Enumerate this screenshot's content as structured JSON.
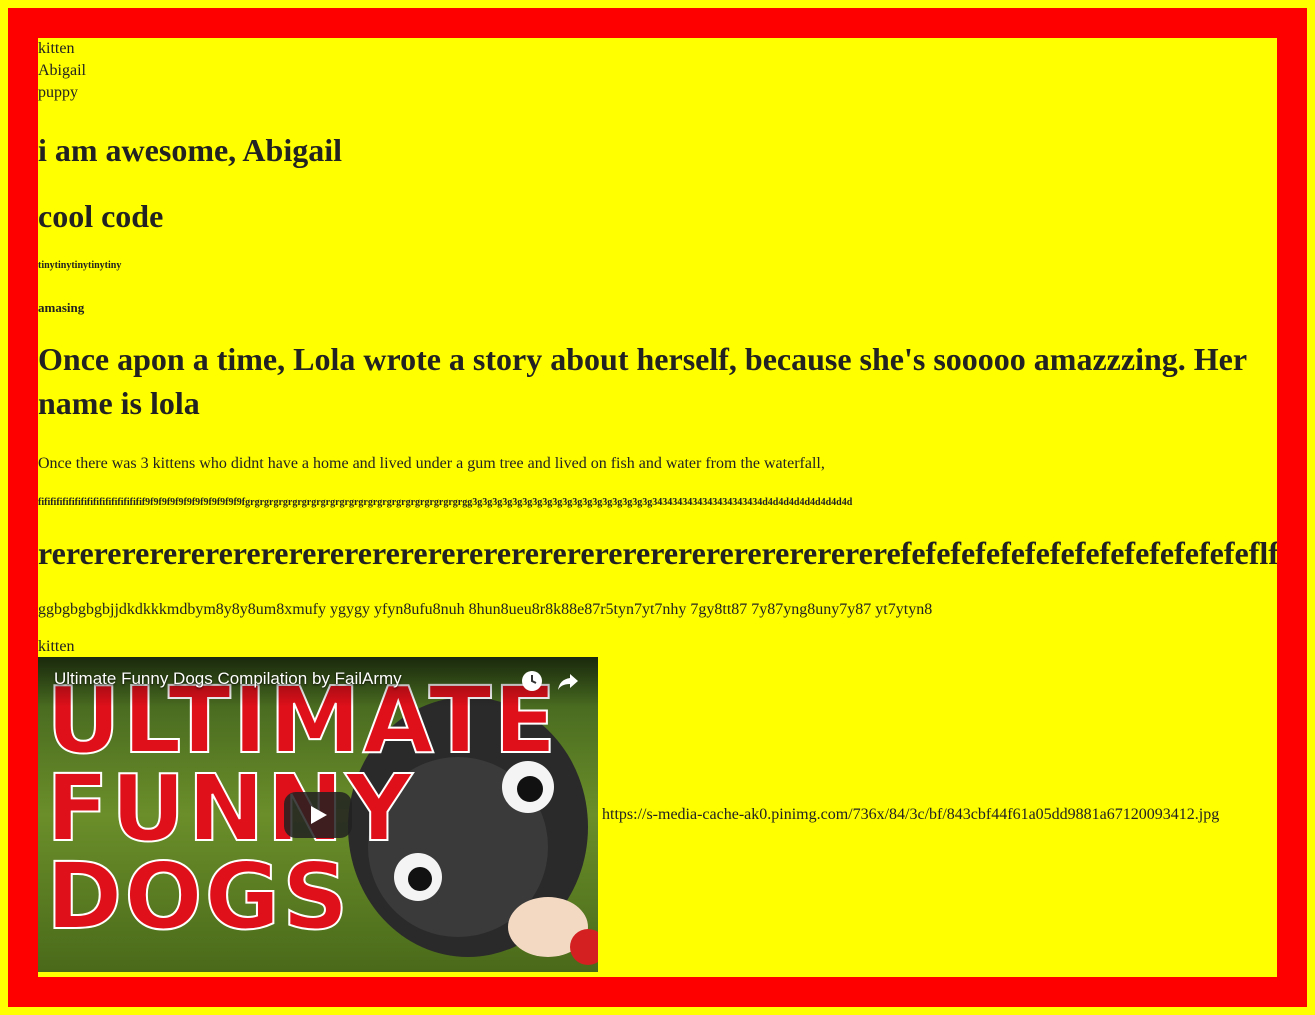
{
  "lines": {
    "kitten_1": "kitten",
    "abigail": "Abigail",
    "puppy": "puppy"
  },
  "headings": {
    "awesome": "i am awesome, Abigail",
    "cool_code": "cool code",
    "tiny": "tinytinytinytinytiny",
    "amasing": "amasing",
    "story": "Once apon a time, Lola wrote a story about herself, because she's sooooo amazzzing. Her name is lola"
  },
  "paragraphs": {
    "kittens": "Once there was 3 kittens who didnt have a home and lived under a gum tree and lived on fish and water from the waterfall,",
    "fi_string": "fififififififififififififififififif9f9f9f9f9f9f9f9f9f9f9f9fgrgrgrgrgrgrgrgrgrgrgrgrgrgrgrgrgrgrgrgrgrgrgrgg3g3g3g3g3g3g3g3g3g3g3g3g3g3g3g3g3g3g3434343434343434343434d4d4d4d4d4d4d4d4d",
    "re_string": "rererererererererererererererererererererererererererererererefefefefefefefefefefefefefefeflflf",
    "gg_string": "ggbgbgbgbjjdkdkkkmdbym8y8y8um8xmufy ygygy yfyn8ufu8nuh 8hun8ueu8r8k88e87r5tyn7yt7nhy 7gy8tt87 7y87yng8uny7y87 yt7ytyn8",
    "kitten_2": "kitten"
  },
  "video": {
    "title": "Ultimate Funny Dogs Compilation by FailArmy",
    "thumbnail_words": [
      "ULTIMATE",
      "FUNNY",
      "DOGS"
    ],
    "icons": [
      "clock-icon",
      "share-icon",
      "play-icon"
    ]
  },
  "image_url": "https://s-media-cache-ak0.pinimg.com/736x/84/3c/bf/843cbf44f61a05dd9881a67120093412.jpg",
  "colors": {
    "outer": "#ffff00",
    "border": "#ff0000",
    "content_bg": "#ffff00",
    "thumbnail_text": "#e0101a"
  }
}
